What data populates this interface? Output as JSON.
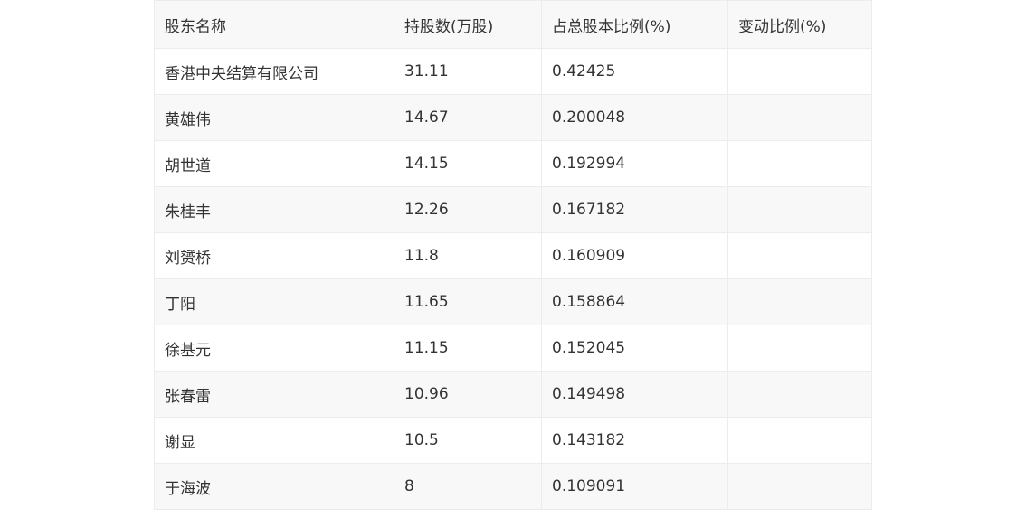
{
  "table": {
    "headers": [
      "股东名称",
      "持股数(万股)",
      "占总股本比例(%)",
      "变动比例(%)"
    ],
    "rows": [
      [
        "香港中央结算有限公司",
        "31.11",
        "0.42425",
        ""
      ],
      [
        "黄雄伟",
        "14.67",
        "0.200048",
        ""
      ],
      [
        "胡世道",
        "14.15",
        "0.192994",
        ""
      ],
      [
        "朱桂丰",
        "12.26",
        "0.167182",
        ""
      ],
      [
        "刘赟桥",
        "11.8",
        "0.160909",
        ""
      ],
      [
        "丁阳",
        "11.65",
        "0.158864",
        ""
      ],
      [
        "徐基元",
        "11.15",
        "0.152045",
        ""
      ],
      [
        "张春雷",
        "10.96",
        "0.149498",
        ""
      ],
      [
        "谢显",
        "10.5",
        "0.143182",
        ""
      ],
      [
        "于海波",
        "8",
        "0.109091",
        ""
      ]
    ]
  }
}
